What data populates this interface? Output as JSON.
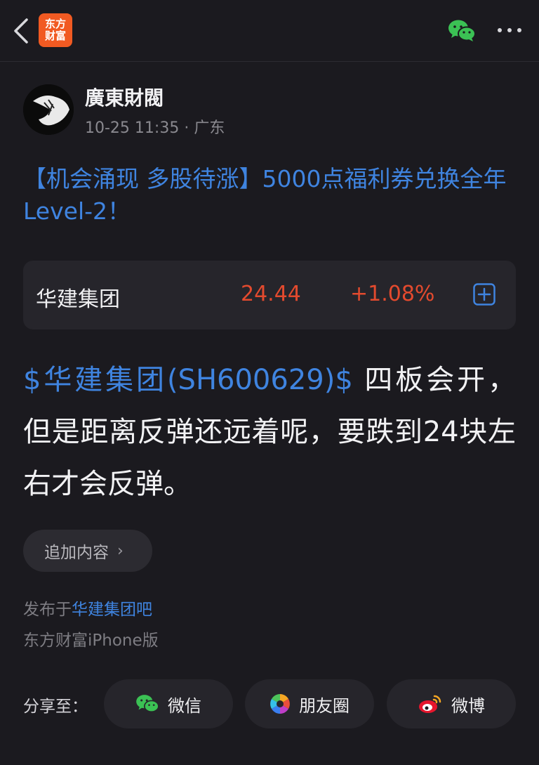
{
  "header": {
    "logo_line1": "东方",
    "logo_line2": "财富"
  },
  "post": {
    "author": "廣東財閥",
    "time": "10-25 11:35",
    "separator": "·",
    "location": "广东",
    "title": "【机会涌现 多股待涨】5000点福利券兑换全年Level-2！",
    "stock_card": {
      "name": "华建集团",
      "price": "24.44",
      "change": "+1.08%",
      "price_color": "#e34a2e"
    },
    "stock_link": "$华建集团(SH600629)$",
    "body": " 四板会开，但是距离反弹还远着呢，要跌到24块左右才会反弹。",
    "add_content_label": "追加内容",
    "published_prefix": "发布于",
    "published_bar": "华建集团吧",
    "client": "东方财富iPhone版"
  },
  "share": {
    "label": "分享至：",
    "wechat": "微信",
    "moments": "朋友圈",
    "weibo": "微博"
  },
  "colors": {
    "background": "#1b1a1f",
    "link": "#3f84e0",
    "rise": "#e34a2e",
    "brand": "#f15a22"
  }
}
